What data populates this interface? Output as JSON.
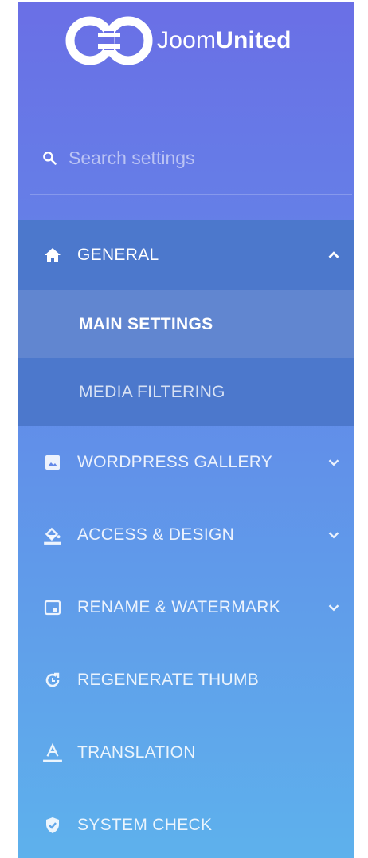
{
  "brand": {
    "part1": "Joom",
    "part2": "United"
  },
  "search": {
    "placeholder": "Search settings"
  },
  "menu": [
    {
      "label": "GENERAL",
      "icon": "home-icon",
      "expanded": true,
      "children": [
        {
          "label": "MAIN SETTINGS",
          "selected": true
        },
        {
          "label": "MEDIA FILTERING",
          "selected": false
        }
      ]
    },
    {
      "label": "WORDPRESS GALLERY",
      "icon": "image-icon",
      "expanded": false
    },
    {
      "label": "ACCESS & DESIGN",
      "icon": "paint-bucket-icon",
      "expanded": false
    },
    {
      "label": "RENAME & WATERMARK",
      "icon": "watermark-icon",
      "expanded": false
    },
    {
      "label": "REGENERATE THUMB",
      "icon": "regenerate-icon"
    },
    {
      "label": "TRANSLATION",
      "icon": "translate-icon"
    },
    {
      "label": "SYSTEM CHECK",
      "icon": "shield-check-icon"
    }
  ],
  "colors": {
    "gradient_top": "#6a6fe6",
    "gradient_bottom": "#5eb1ec",
    "active_section": "#4c78cc",
    "selected_sub": "#6186d0",
    "text": "#ffffff"
  }
}
